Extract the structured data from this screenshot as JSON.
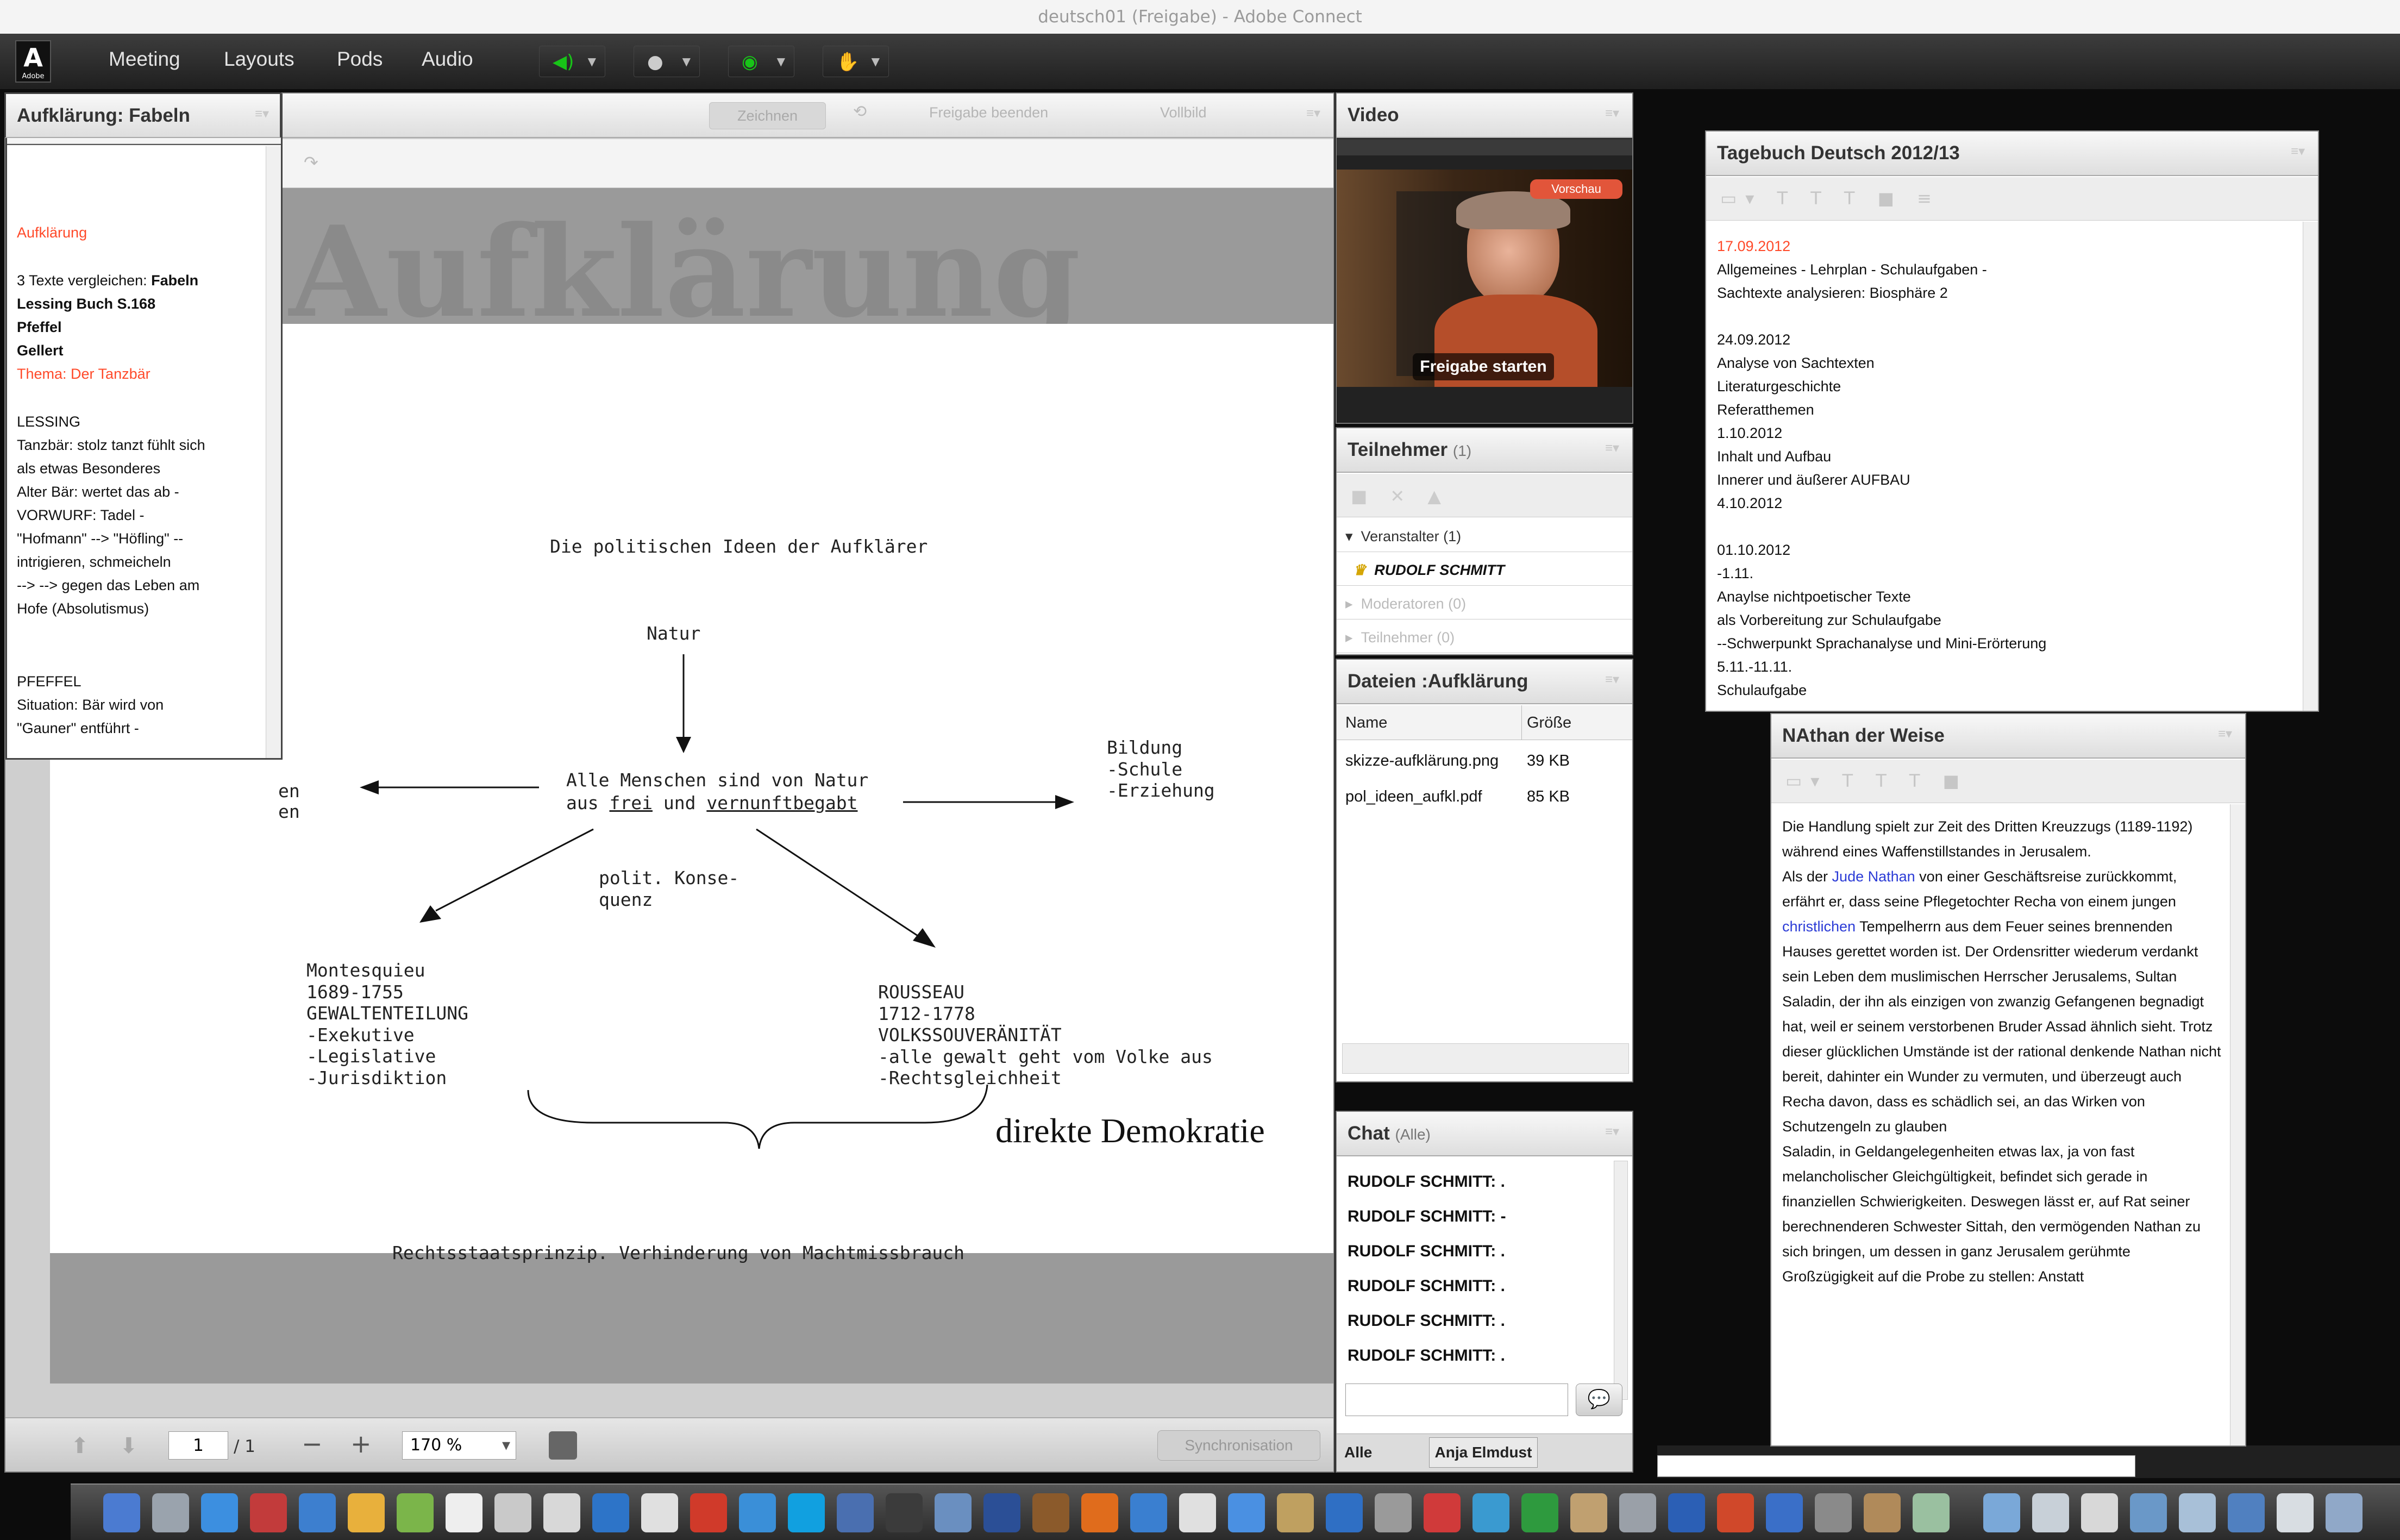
{
  "window": {
    "title": "deutsch01 (Freigabe) - Adobe Connect"
  },
  "logo": {
    "text": "A",
    "sub": "Adobe"
  },
  "menus": [
    "Meeting",
    "Layouts",
    "Pods",
    "Audio"
  ],
  "toolbar_icons": [
    "speaker-icon",
    "microphone-icon",
    "webcam-icon",
    "hand-icon"
  ],
  "share_pod": {
    "title": "Aufklärung: Fabeln",
    "buttons": {
      "draw": "Zeichnen",
      "stop": "Freigabe beenden",
      "fullscreen": "Vollbild"
    },
    "notes": {
      "heading": "Aufklärung",
      "line1_pre": "3 Texte vergleichen: ",
      "line1_bold": "Fabeln",
      "line2": "Lessing  Buch S.168",
      "line3": "Pfeffel",
      "line4": "Gellert",
      "theme": "Thema: Der Tanzbär",
      "lessing_title": "LESSING",
      "lessing": [
        "Tanzbär: stolz tanzt fühlt sich",
        "als etwas Besonderes",
        "Alter Bär: wertet das ab -",
        "VORWURF: Tadel -",
        "\"Hofmann\" --> \"Höfling\" --",
        "intrigieren, schmeicheln",
        "--> --> gegen das Leben am",
        "Hofe (Absolutismus)"
      ],
      "pfeffel_title": "PFEFFEL",
      "pfeffel": [
        "Situation: Bär wird von",
        "\"Gauner\" entführt -"
      ]
    },
    "banner_text": "Aufklärung",
    "document": {
      "title": "Die politischen Ideen der Aufklärer",
      "natur": "Natur",
      "center_line1": "Alle Menschen sind von Natur",
      "center_line2_pre": "aus ",
      "center_frei": "frei",
      "center_mid": " und ",
      "center_vern": "vernunftbegabt",
      "left_cut1": "en",
      "left_cut2": "en",
      "bildung": "Bildung\n-Schule\n-Erziehung",
      "konsequenz": "polit. Konse-\nquenz",
      "montesquieu": "Montesquieu\n1689-1755\nGEWALTENTEILUNG\n-Exekutive\n-Legislative\n-Jurisdiktion",
      "rousseau": "ROUSSEAU\n1712-1778\nVOLKSSOUVERÄNITÄT\n-alle gewalt geht vom Volke aus\n-Rechtsgleichheit",
      "handwritten": "direkte Demokratie",
      "bottom": "Rechtsstaatsprinzip. Verhinderung von Machtmissbrauch"
    },
    "footer": {
      "page": "1",
      "total": "/ 1",
      "zoom": "170 %",
      "sync": "Synchronisation"
    }
  },
  "video_pod": {
    "title": "Video",
    "badge": "Vorschau",
    "start": "Freigabe starten"
  },
  "attendees_pod": {
    "title": "Teilnehmer",
    "count": "(1)",
    "groups": [
      {
        "label": "Veranstalter (1)",
        "expanded": true
      },
      {
        "label": "Moderatoren (0)",
        "expanded": false
      },
      {
        "label": "Teilnehmer (0)",
        "expanded": false
      }
    ],
    "host": "RUDOLF SCHMITT"
  },
  "files_pod": {
    "title": "Dateien :Aufklärung",
    "headers": [
      "Name",
      "Größe"
    ],
    "rows": [
      {
        "name": "skizze-aufklärung.png",
        "size": "39 KB"
      },
      {
        "name": "pol_ideen_aufkl.pdf",
        "size": "85 KB"
      }
    ]
  },
  "chat_pod": {
    "title": "Chat",
    "scope": "(Alle)",
    "messages": [
      "RUDOLF SCHMITT: .",
      "RUDOLF SCHMITT: -",
      "RUDOLF SCHMITT: .",
      "RUDOLF SCHMITT: .",
      "RUDOLF SCHMITT: .",
      "RUDOLF SCHMITT: ."
    ],
    "tabs": [
      "Alle",
      "Anja Elmdust"
    ]
  },
  "diary_pod": {
    "title": "Tagebuch Deutsch 2012/13",
    "date_red": "17.09.2012",
    "lines": [
      "Allgemeines - Lehrplan - Schulaufgaben -",
      "Sachtexte analysieren: Biosphäre 2",
      "",
      "24.09.2012",
      "Analyse von Sachtexten",
      "Literaturgeschichte",
      "Referatthemen",
      "1.10.2012",
      "Inhalt und Aufbau",
      "Innerer und äußerer AUFBAU",
      "4.10.2012",
      "",
      "01.10.2012",
      "-1.11.",
      "Anaylse  nichtpoetischer Texte",
      "als Vorbereitung zur Schulaufgabe",
      "--Schwerpunkt Sprachanalyse und Mini-Erörterung",
      "5.11.-11.11.",
      "Schulaufgabe"
    ]
  },
  "nathan_pod": {
    "title": "NAthan der Weise",
    "p1": "Die Handlung spielt zur Zeit des Dritten Kreuzzugs (1189-1192) während eines Waffenstillstandes in Jerusalem.",
    "p2_a": "Als der ",
    "p2_link1": "Jude Nathan",
    "p2_b": " von einer Geschäftsreise zurückkommt, erfährt er, dass seine Pflegetochter Recha von einem jungen ",
    "p2_link2": "christlichen",
    "p2_c": " Tempelherrn aus dem Feuer seines brennenden Hauses gerettet worden ist. Der Ordensritter wiederum verdankt sein Leben dem muslimischen Herrscher Jerusalems, Sultan Saladin, der ihn als einzigen von zwanzig Gefangenen begnadigt hat, weil er seinem verstorbenen Bruder Assad ähnlich sieht. Trotz dieser glücklichen Umstände ist der rational denkende Nathan nicht bereit, dahinter ein Wunder zu vermuten, und überzeugt auch Recha davon, dass es schädlich sei, an das Wirken von Schutzengeln zu glauben",
    "p3": "Saladin, in Geldangelegenheiten etwas lax, ja von fast melancholischer Gleichgültigkeit, befindet sich gerade in finanziellen Schwierigkeiten. Deswegen lässt er, auf Rat seiner berechnenderen Schwester Sittah, den vermögenden Nathan zu sich bringen, um dessen in ganz Jerusalem gerühmte Großzügigkeit auf die Probe zu stellen: Anstatt"
  },
  "colors": {
    "accent_red": "#ff4a2a",
    "link_blue": "#2b3bd6",
    "mic_green": "#18c418"
  }
}
